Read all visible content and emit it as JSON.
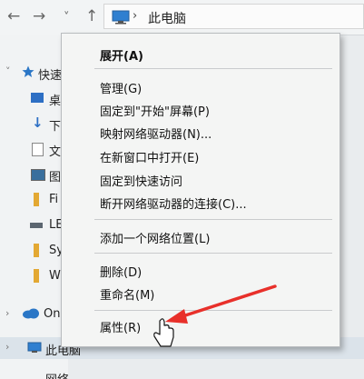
{
  "address_bar": {
    "path": "此电脑"
  },
  "nav_buttons": {
    "back": "←",
    "forward": "→",
    "dropdown": "˅",
    "up": "↑"
  },
  "nav_pane": {
    "quick_access": "快速",
    "items": [
      "桌",
      "下",
      "文",
      "图",
      "Fi",
      "LE",
      "Sy",
      "W"
    ],
    "onedrive": "On",
    "this_pc": "此电脑",
    "network": "网络"
  },
  "context_menu": {
    "items": [
      "展开(A)",
      "管理(G)",
      "固定到\"开始\"屏幕(P)",
      "映射网络驱动器(N)...",
      "在新窗口中打开(E)",
      "固定到快速访问",
      "断开网络驱动器的连接(C)...",
      "添加一个网络位置(L)",
      "删除(D)",
      "重命名(M)",
      "属性(R)"
    ]
  },
  "colors": {
    "accent": "#1a73c7",
    "arrow": "#e8302a"
  }
}
